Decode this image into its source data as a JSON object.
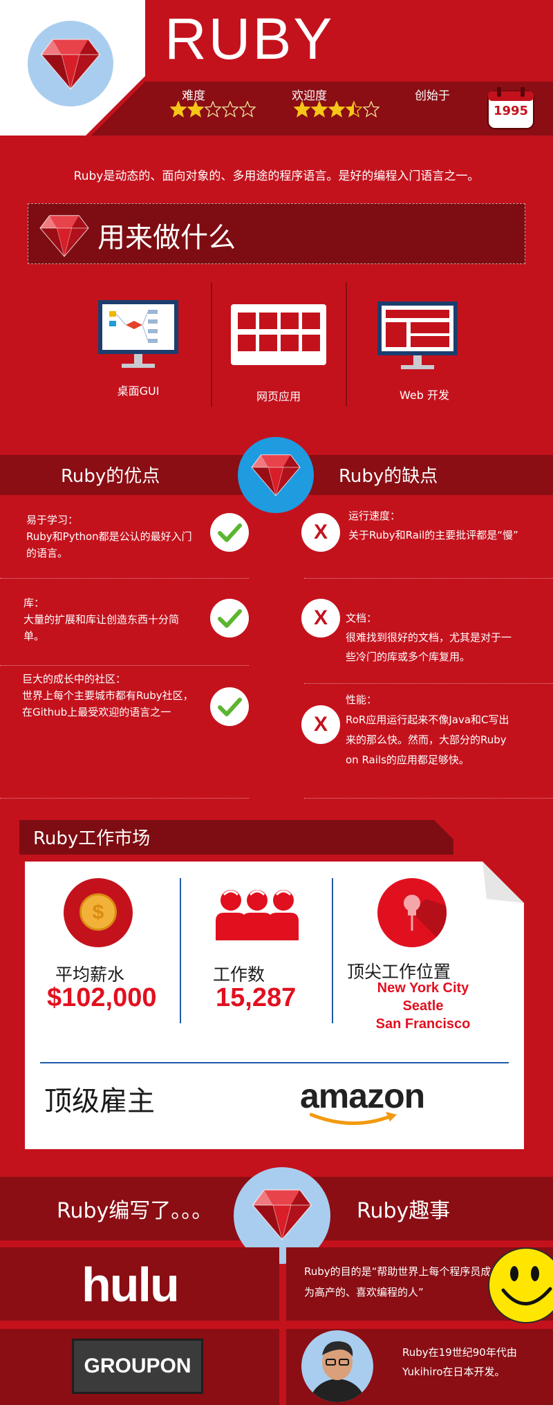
{
  "header": {
    "title": "RUBY",
    "difficulty_label": "难度",
    "difficulty_stars": 2,
    "popularity_label": "欢迎度",
    "popularity_stars": 3.5,
    "founded_label": "创始于",
    "founded_year": "1995",
    "max_stars": 5
  },
  "intro": "Ruby是动态的、面向对象的、多用途的程序语言。是好的编程入门语言之一。",
  "uses": {
    "heading": "用来做什么",
    "items": [
      {
        "label": "桌面GUI",
        "icon": "desktop-gui-icon"
      },
      {
        "label": "网页应用",
        "icon": "web-app-grid-icon"
      },
      {
        "label": "Web 开发",
        "icon": "web-dev-monitor-icon"
      }
    ]
  },
  "pros_cons": {
    "pros_title": "Ruby的优点",
    "cons_title": "Ruby的缺点",
    "pros": [
      {
        "title": "易于学习：",
        "body": "Ruby和Python都是公认的最好入门的语言。"
      },
      {
        "title": "库：",
        "body": "大量的扩展和库让创造东西十分简单。"
      },
      {
        "title": "巨大的成长中的社区：",
        "body": "世界上每个主要城市都有Ruby社区，在Github上最受欢迎的语言之一"
      }
    ],
    "cons": [
      {
        "title": "运行速度：",
        "body": "关于Ruby和Rail的主要批评都是“慢”"
      },
      {
        "title": "文档：",
        "body": "很难找到很好的文档，尤其是对于一些冷门的库或多个库复用。"
      },
      {
        "title": "性能：",
        "body": "RoR应用运行起来不像Java和C写出来的那么快。然而，大部分的Ruby on Rails的应用都足够快。"
      }
    ]
  },
  "jobs": {
    "heading": "Ruby工作市场",
    "salary_label": "平均薪水",
    "salary_value": "$102,000",
    "count_label": "工作数",
    "count_value": "15,287",
    "top_label": "顶尖工作位置",
    "top_locations": [
      "New York City",
      "Seatle",
      "San Francisco"
    ],
    "employer_label": "顶级雇主",
    "employer_logo": "amazon"
  },
  "bottom": {
    "written_title": "Ruby编写了。。。",
    "fun_title": "Ruby趣事",
    "apps": [
      "hulu",
      "GROUPON"
    ],
    "facts": [
      "Ruby的目的是“帮助世界上每个程序员成为高产的、喜欢编程的人”",
      "Ruby在19世纪90年代由Yukihiro在日本开发。"
    ]
  },
  "colors": {
    "brand_red": "#c4121d",
    "dark_red": "#8a0e14",
    "accent_blue": "#1f9be0",
    "light_blue": "#a9cdee",
    "star_yellow": "#f5c518"
  }
}
